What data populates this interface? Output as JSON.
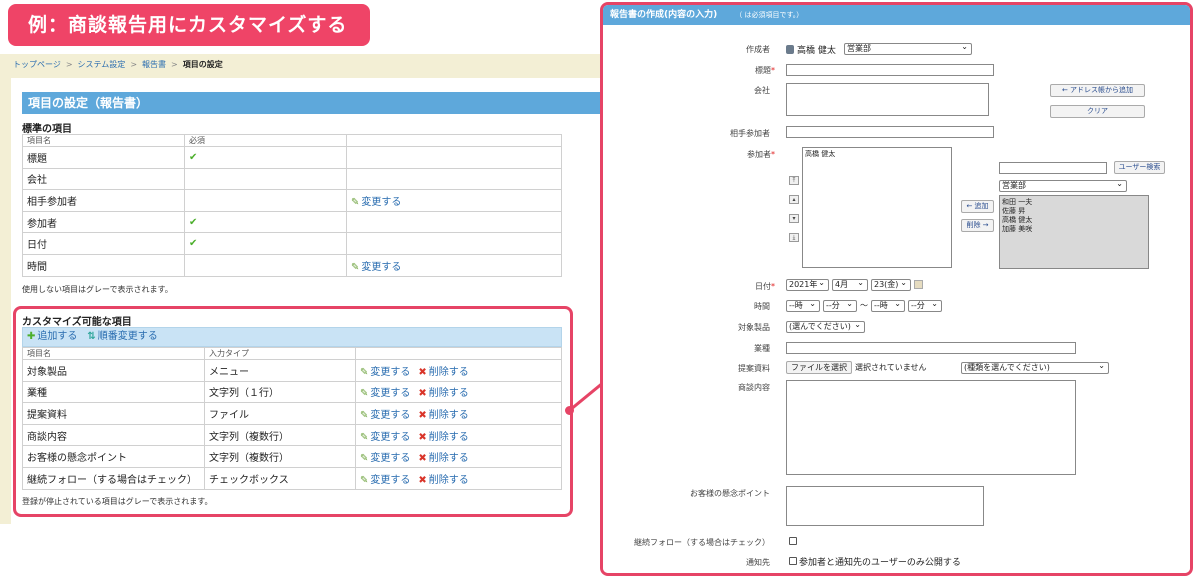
{
  "banner": "例：商談報告用にカスタマイズする",
  "breadcrumb": [
    "トップページ",
    "システム設定",
    "報告書",
    "項目の設定"
  ],
  "left": {
    "title": "項目の設定（報告書）",
    "standard": {
      "heading": "標準の項目",
      "col_name": "項目名",
      "col_required": "必須",
      "rows": [
        {
          "name": "標題",
          "required": "✔",
          "action": ""
        },
        {
          "name": "会社",
          "required": "",
          "action": ""
        },
        {
          "name": "相手参加者",
          "required": "",
          "action": "変更する"
        },
        {
          "name": "参加者",
          "required": "✔",
          "action": ""
        },
        {
          "name": "日付",
          "required": "✔",
          "action": ""
        },
        {
          "name": "時間",
          "required": "",
          "action": "変更する"
        }
      ],
      "note": "使用しない項目はグレーで表示されます。"
    },
    "custom": {
      "heading": "カスタマイズ可能な項目",
      "add_label": "追加する",
      "reorder_label": "順番変更する",
      "col_name": "項目名",
      "col_type": "入力タイプ",
      "edit_label": "変更する",
      "delete_label": "削除する",
      "rows": [
        {
          "name": "対象製品",
          "type": "メニュー"
        },
        {
          "name": "業種",
          "type": "文字列（１行）"
        },
        {
          "name": "提案資料",
          "type": "ファイル"
        },
        {
          "name": "商談内容",
          "type": "文字列（複数行）"
        },
        {
          "name": "お客様の懸念ポイント",
          "type": "文字列（複数行）"
        },
        {
          "name": "継続フォロー（する場合はチェック）",
          "type": "チェックボックス"
        }
      ],
      "note": "登録が停止されている項目はグレーで表示されます。"
    }
  },
  "form": {
    "title": "報告書の作成(内容の入力)",
    "hint": "（ は必須項目です。）",
    "author_label": "作成者",
    "author_name": "高橋 健太",
    "author_dept": "営業部",
    "title_label": "標題",
    "company_label": "会社",
    "address_book_btn": "← アドレス帳から追加",
    "clear_btn": "クリア",
    "partner_label": "相手参加者",
    "participants_label": "参加者",
    "participants_selected": [
      "高橋 健太"
    ],
    "user_search_btn": "ユーザー検索",
    "dept_select": "営業部",
    "add_btn": "← 追加",
    "remove_btn": "削除 →",
    "candidates": [
      "和田 一夫",
      "佐藤 昇",
      "高橋 健太",
      "加藤 美咲"
    ],
    "date_label": "日付",
    "date_year": "2021年",
    "date_month": "4月",
    "date_day": "23(金)",
    "time_label": "時間",
    "time_hour": "--時",
    "time_min": "--分",
    "time_sep": "〜",
    "product_label": "対象製品",
    "product_select": "(選んでください)",
    "industry_label": "業種",
    "material_label": "提案資料",
    "file_btn": "ファイルを選択",
    "file_none": "選択されていません",
    "material_type": "(種類を選んでください)",
    "content_label": "商談内容",
    "concern_label": "お客様の懸念ポイント",
    "follow_label": "継続フォロー（する場合はチェック）",
    "notify_label": "通知先",
    "notify_option": "参加者と通知先のユーザーのみ公開する"
  },
  "colors": {
    "accent": "#e64466",
    "header": "#5ea8db",
    "link": "#2a6db0"
  }
}
